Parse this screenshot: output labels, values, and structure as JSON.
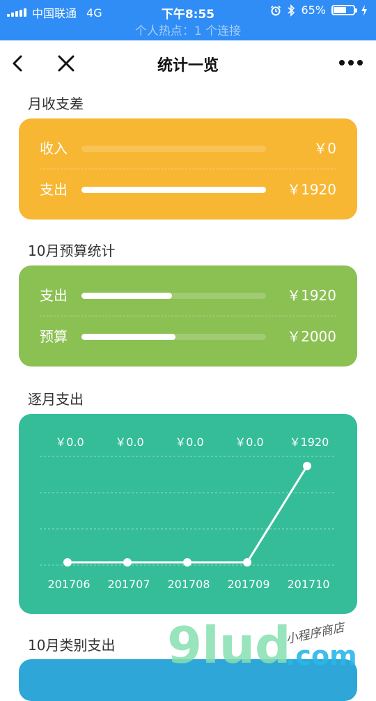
{
  "status_bar": {
    "carrier": "中国联通",
    "network": "4G",
    "time": "下午8:55",
    "battery": "65%",
    "hotspot": "个人热点：1 个连接"
  },
  "nav": {
    "title": "统计一览"
  },
  "monthly_diff": {
    "title": "月收支差",
    "income_label": "收入",
    "income_value": "￥0",
    "income_fraction": 0,
    "expense_label": "支出",
    "expense_value": "￥1920",
    "expense_fraction": 1
  },
  "budget": {
    "title": "10月预算统计",
    "expense_label": "支出",
    "expense_value": "￥1920",
    "expense_fraction": 0.49,
    "budget_label": "预算",
    "budget_value": "￥2000",
    "budget_fraction": 0.51
  },
  "monthly_expense": {
    "title": "逐月支出",
    "chart_data": {
      "type": "line",
      "categories": [
        "201706",
        "201707",
        "201708",
        "201709",
        "201710"
      ],
      "values": [
        0,
        0,
        0,
        0,
        1920
      ],
      "value_labels": [
        "￥0.0",
        "￥0.0",
        "￥0.0",
        "￥0.0",
        "￥1920"
      ],
      "ylim": [
        0,
        2000
      ],
      "grid": true
    }
  },
  "category_expense": {
    "title": "10月类别支出"
  },
  "watermark": {
    "brand": "9lud",
    "tld": ".com",
    "slogan": "小程序商店"
  },
  "colors": {
    "status_blue": "#2f8df5",
    "orange": "#f7b733",
    "green": "#8bc053",
    "teal": "#35bd99",
    "blue": "#2ea7d8"
  }
}
